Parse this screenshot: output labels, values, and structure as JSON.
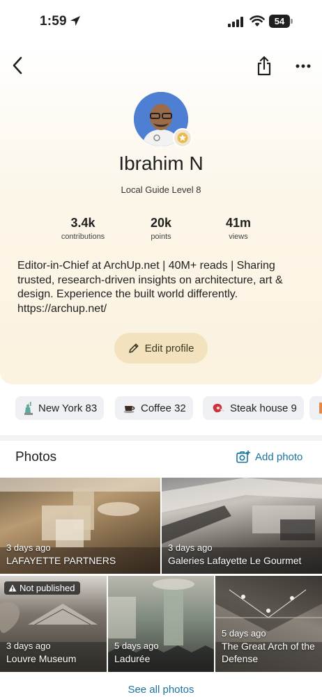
{
  "status_bar": {
    "time": "1:59",
    "battery": "54"
  },
  "profile": {
    "name": "Ibrahim N",
    "level": "Local Guide Level 8",
    "stats": [
      {
        "value": "3.4k",
        "label": "contributions"
      },
      {
        "value": "20k",
        "label": "points"
      },
      {
        "value": "41m",
        "label": "views"
      }
    ],
    "bio": "Editor-in-Chief at ArchUp.net | 40M+ reads | Sharing trusted, research-driven insights on architecture, art & design. Experience the built world differently. https://archup.net/",
    "edit_label": "Edit profile"
  },
  "chips": [
    {
      "icon": "statue-of-liberty-icon",
      "label": "New York 83"
    },
    {
      "icon": "coffee-cup-icon",
      "label": "Coffee 32"
    },
    {
      "icon": "steak-icon",
      "label": "Steak house 9"
    }
  ],
  "photos": {
    "title": "Photos",
    "add_label": "Add photo",
    "see_all": "See all photos",
    "not_published": "Not published",
    "items": [
      {
        "time": "3 days ago",
        "title": "LAFAYETTE PARTNERS"
      },
      {
        "time": "3 days ago",
        "title": "Galeries Lafayette Le Gourmet"
      },
      {
        "time": "3 days ago",
        "title": "Louvre Museum"
      },
      {
        "time": "5 days ago",
        "title": "Ladurée"
      },
      {
        "time": "5 days ago",
        "title": "The Great Arch of the Defense"
      }
    ]
  },
  "colors": {
    "accent": "#1a73a0",
    "edit_button": "#f2e3be",
    "chip_bg": "#eef0f3",
    "avatar_bg": "#4f7fd3"
  }
}
